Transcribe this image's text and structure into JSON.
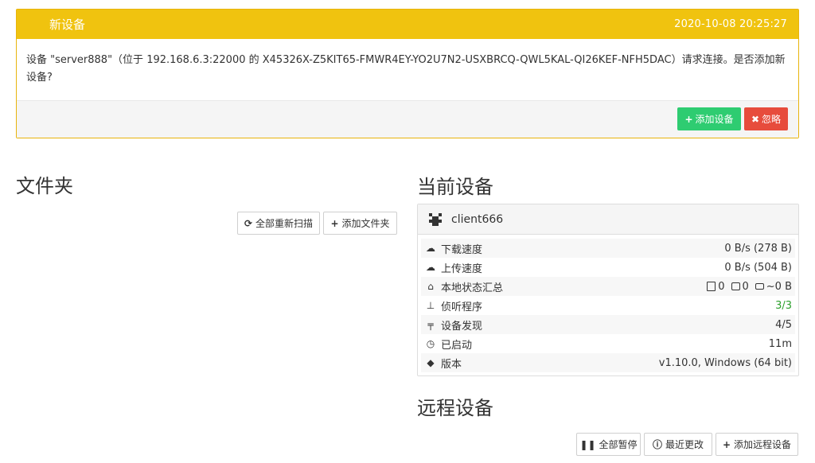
{
  "notice": {
    "title": "新设备",
    "timestamp": "2020-10-08 20:25:27",
    "message": "设备 \"server888\"（位于 192.168.6.3:22000 的 X45326X-Z5KIT65-FMWR4EY-YO2U7N2-USXBRCQ-QWL5KAL-QI26KEF-NFH5DAC）请求连接。是否添加新设备?",
    "add_label": "添加设备",
    "ignore_label": "忽略"
  },
  "folders": {
    "heading": "文件夹",
    "rescan_label": "全部重新扫描",
    "add_label": "添加文件夹"
  },
  "this_device": {
    "heading": "当前设备",
    "name": "client666",
    "rows": [
      {
        "icon": "cloud-download-icon",
        "label": "下载速度",
        "value": "0 B/s (278 B)"
      },
      {
        "icon": "cloud-upload-icon",
        "label": "上传速度",
        "value": "0 B/s (504 B)"
      },
      {
        "icon": "home-icon",
        "label": "本地状态汇总",
        "files": "0",
        "dirs": "0",
        "size": "~0 B"
      },
      {
        "icon": "sitemap-icon",
        "label": "侦听程序",
        "value": "3/3"
      },
      {
        "icon": "signpost-icon",
        "label": "设备发现",
        "value": "4/5"
      },
      {
        "icon": "clock-icon",
        "label": "已启动",
        "value": "11m"
      },
      {
        "icon": "tag-icon",
        "label": "版本",
        "value": "v1.10.0, Windows (64 bit)"
      }
    ]
  },
  "remote": {
    "heading": "远程设备",
    "pause_all_label": "全部暂停",
    "recent_changes_label": "最近更改",
    "add_remote_label": "添加远程设备"
  },
  "colors": {
    "notice_header": "#f0c30f",
    "success": "#2ecc71",
    "danger": "#e74c3c",
    "listeners_ok": "#2ca02c"
  }
}
